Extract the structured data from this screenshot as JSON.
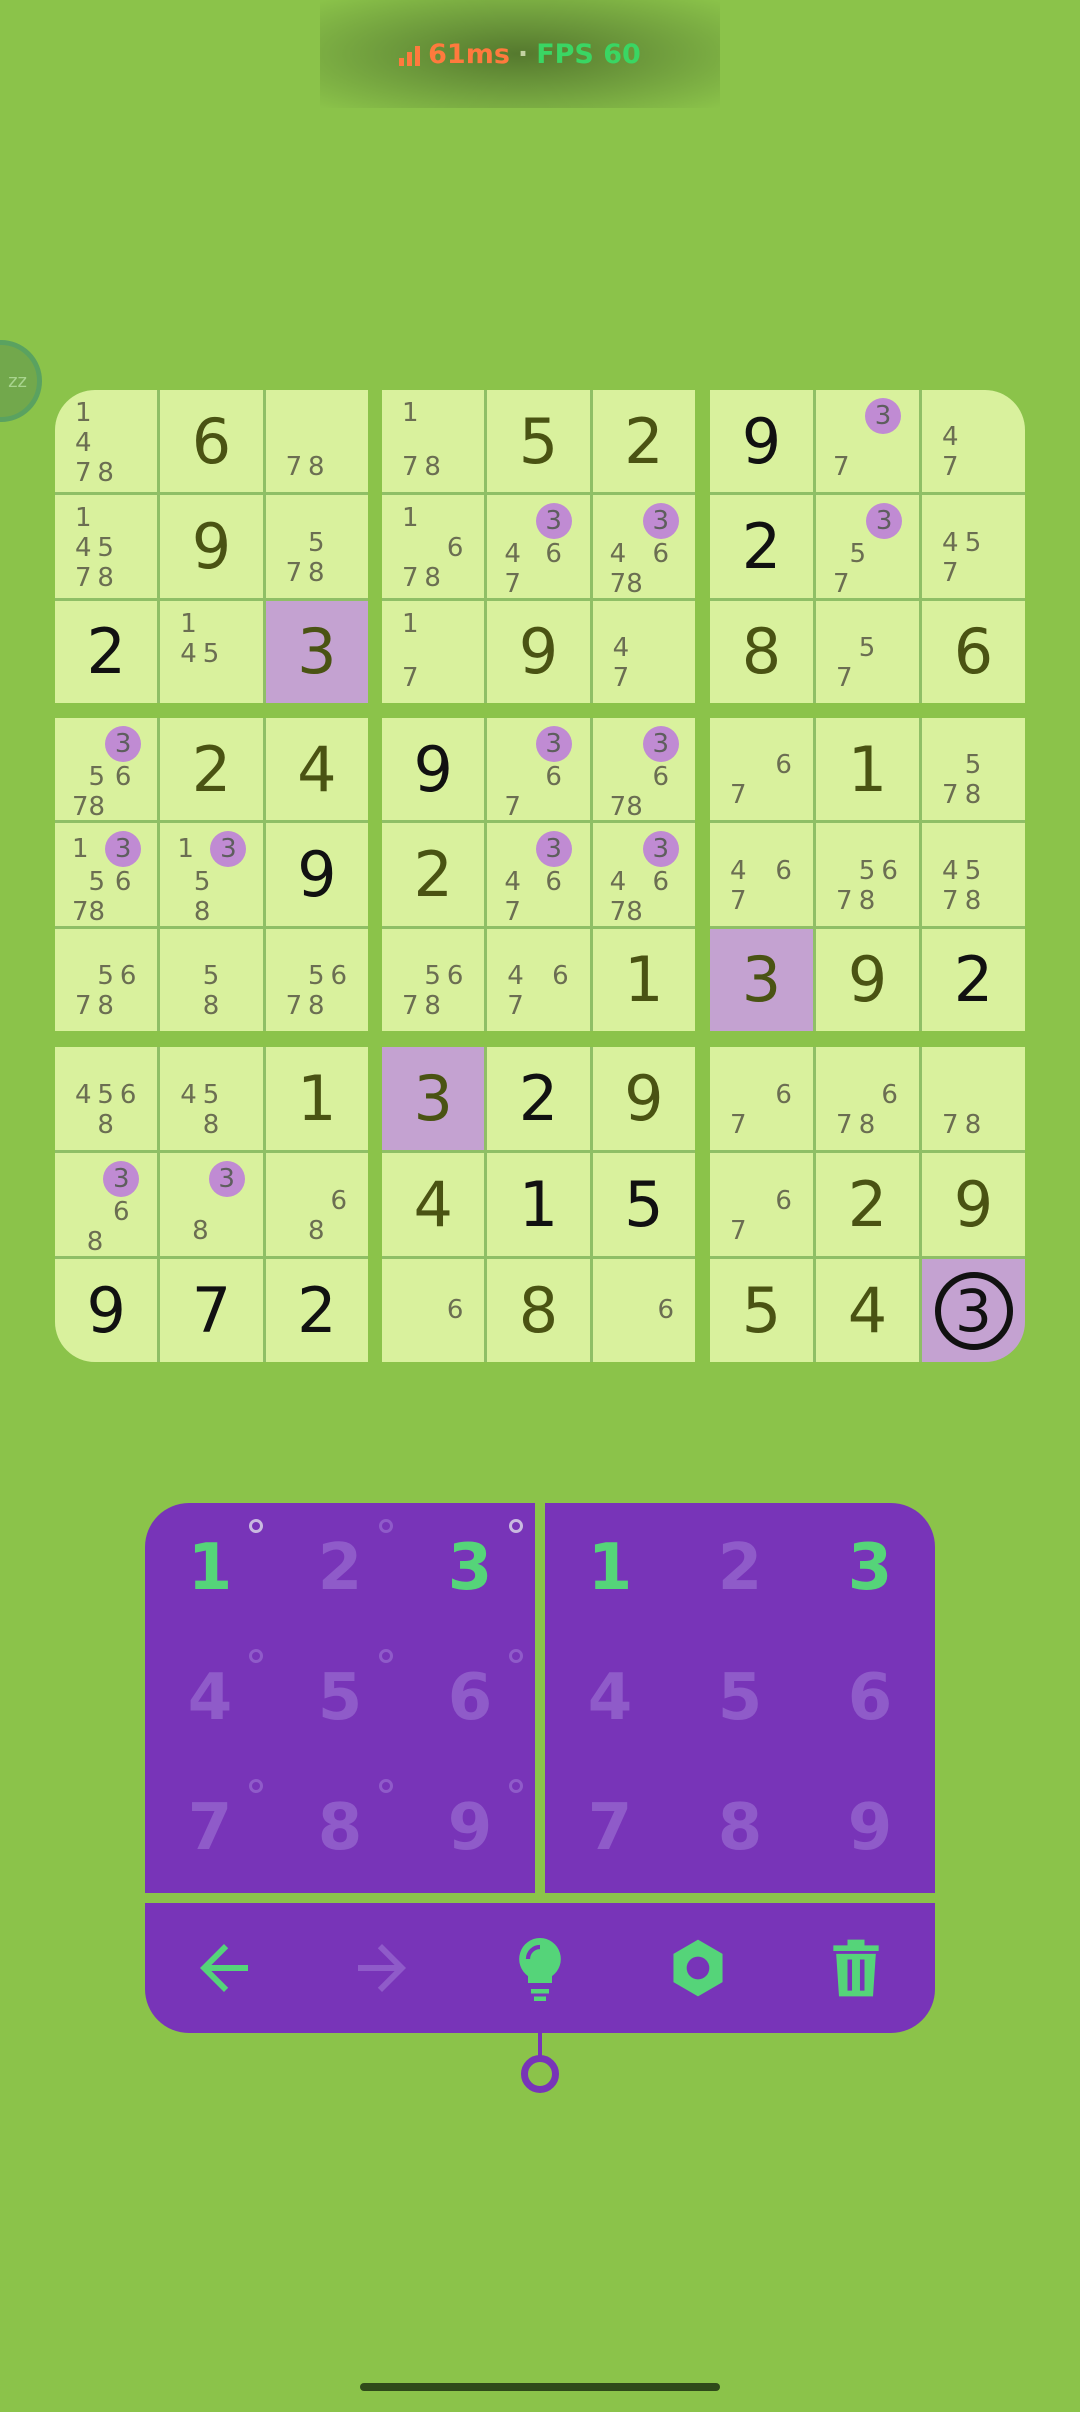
{
  "status": {
    "latency": "61ms",
    "separator": "·",
    "fps": "FPS 60"
  },
  "sleep_badge": {
    "label": "zz"
  },
  "board": {
    "boxes": [
      [
        {
          "v": "",
          "n": [
            "1",
            "",
            "",
            "4",
            "",
            "",
            "7",
            "8",
            ""
          ],
          "m": []
        },
        {
          "v": "6",
          "t": "g",
          "n": [],
          "m": []
        },
        {
          "v": "",
          "n": [
            "",
            "",
            "",
            "",
            "",
            "",
            "7",
            "8",
            ""
          ],
          "m": []
        },
        {
          "v": "",
          "n": [
            "1",
            "",
            "",
            "4",
            "5",
            "",
            "7",
            "8",
            ""
          ],
          "m": []
        },
        {
          "v": "9",
          "t": "g",
          "n": [],
          "m": []
        },
        {
          "v": "",
          "n": [
            "",
            "",
            "",
            "",
            "5",
            "",
            "7",
            "8",
            ""
          ],
          "m": []
        },
        {
          "v": "2",
          "t": "u",
          "n": [],
          "m": []
        },
        {
          "v": "",
          "n": [
            "1",
            "",
            "",
            "4",
            "5",
            "",
            "",
            "",
            ""
          ],
          "m": []
        },
        {
          "v": "3",
          "t": "g",
          "h": true,
          "n": [],
          "m": []
        }
      ],
      [
        {
          "v": "",
          "n": [
            "1",
            "",
            "",
            "",
            "",
            "",
            "7",
            "8",
            ""
          ],
          "m": []
        },
        {
          "v": "5",
          "t": "g",
          "n": [],
          "m": []
        },
        {
          "v": "2",
          "t": "g",
          "n": [],
          "m": []
        },
        {
          "v": "",
          "n": [
            "1",
            "",
            "",
            "",
            "",
            "6",
            "7",
            "8",
            ""
          ],
          "m": []
        },
        {
          "v": "",
          "n": [
            "",
            "",
            "3",
            "4",
            "",
            "6",
            "7",
            "",
            ""
          ],
          "m": [
            "3"
          ]
        },
        {
          "v": "",
          "n": [
            "",
            "",
            "3",
            "4",
            "",
            "6",
            "7",
            "8",
            ""
          ],
          "m": [
            "3"
          ]
        },
        {
          "v": "",
          "n": [
            "1",
            "",
            "",
            "",
            "",
            "",
            "7",
            "",
            ""
          ],
          "m": []
        },
        {
          "v": "9",
          "t": "g",
          "n": [],
          "m": []
        },
        {
          "v": "",
          "n": [
            "",
            "",
            "",
            "4",
            "",
            "",
            "7",
            "",
            ""
          ],
          "m": []
        }
      ],
      [
        {
          "v": "9",
          "t": "u",
          "n": [],
          "m": []
        },
        {
          "v": "",
          "n": [
            "",
            "",
            "3",
            "",
            "",
            "",
            "7",
            "",
            ""
          ],
          "m": [
            "3"
          ]
        },
        {
          "v": "",
          "n": [
            "",
            "",
            "",
            "4",
            "",
            "",
            "7",
            "",
            ""
          ],
          "m": []
        },
        {
          "v": "2",
          "t": "u",
          "n": [],
          "m": []
        },
        {
          "v": "",
          "n": [
            "",
            "",
            "3",
            "",
            "5",
            "",
            "7",
            "",
            ""
          ],
          "m": [
            "3"
          ]
        },
        {
          "v": "",
          "n": [
            "",
            "",
            "",
            "4",
            "5",
            "",
            "7",
            "",
            ""
          ],
          "m": []
        },
        {
          "v": "8",
          "t": "g",
          "n": [],
          "m": []
        },
        {
          "v": "",
          "n": [
            "",
            "",
            "",
            "",
            "5",
            "",
            "7",
            "",
            ""
          ],
          "m": []
        },
        {
          "v": "6",
          "t": "g",
          "n": [],
          "m": []
        }
      ],
      [
        {
          "v": "",
          "n": [
            "",
            "",
            "3",
            "",
            "5",
            "6",
            "7",
            "8",
            ""
          ],
          "m": [
            "3"
          ]
        },
        {
          "v": "2",
          "t": "g",
          "n": [],
          "m": []
        },
        {
          "v": "4",
          "t": "g",
          "n": [],
          "m": []
        },
        {
          "v": "",
          "n": [
            "1",
            "",
            "3",
            "",
            "5",
            "6",
            "7",
            "8",
            ""
          ],
          "m": [
            "3"
          ]
        },
        {
          "v": "",
          "n": [
            "1",
            "",
            "3",
            "",
            "5",
            "",
            "",
            "8",
            ""
          ],
          "m": [
            "3"
          ]
        },
        {
          "v": "9",
          "t": "u",
          "n": [],
          "m": []
        },
        {
          "v": "",
          "n": [
            "",
            "",
            "",
            "",
            "5",
            "6",
            "7",
            "8",
            ""
          ],
          "m": []
        },
        {
          "v": "",
          "n": [
            "",
            "",
            "",
            "",
            "5",
            "",
            "",
            "8",
            ""
          ],
          "m": []
        },
        {
          "v": "",
          "n": [
            "",
            "",
            "",
            "",
            "5",
            "6",
            "7",
            "8",
            ""
          ],
          "m": []
        }
      ],
      [
        {
          "v": "9",
          "t": "u",
          "n": [],
          "m": []
        },
        {
          "v": "",
          "n": [
            "",
            "",
            "3",
            "",
            "",
            "6",
            "7",
            "",
            ""
          ],
          "m": [
            "3"
          ]
        },
        {
          "v": "",
          "n": [
            "",
            "",
            "3",
            "",
            "",
            "6",
            "7",
            "8",
            ""
          ],
          "m": [
            "3"
          ]
        },
        {
          "v": "2",
          "t": "g",
          "n": [],
          "m": []
        },
        {
          "v": "",
          "n": [
            "",
            "",
            "3",
            "4",
            "",
            "6",
            "7",
            "",
            ""
          ],
          "m": [
            "3"
          ]
        },
        {
          "v": "",
          "n": [
            "",
            "",
            "3",
            "4",
            "",
            "6",
            "7",
            "8",
            ""
          ],
          "m": [
            "3"
          ]
        },
        {
          "v": "",
          "n": [
            "",
            "",
            "",
            "",
            "5",
            "6",
            "7",
            "8",
            ""
          ],
          "m": []
        },
        {
          "v": "",
          "n": [
            "",
            "",
            "",
            "4",
            "",
            "6",
            "7",
            "",
            ""
          ],
          "m": []
        },
        {
          "v": "1",
          "t": "g",
          "n": [],
          "m": []
        }
      ],
      [
        {
          "v": "",
          "n": [
            "",
            "",
            "",
            "",
            "",
            "6",
            "7",
            "",
            ""
          ],
          "m": []
        },
        {
          "v": "1",
          "t": "g",
          "n": [],
          "m": []
        },
        {
          "v": "",
          "n": [
            "",
            "",
            "",
            "",
            "5",
            "",
            "7",
            "8",
            ""
          ],
          "m": []
        },
        {
          "v": "",
          "n": [
            "",
            "",
            "",
            "4",
            "",
            "6",
            "7",
            "",
            ""
          ],
          "m": []
        },
        {
          "v": "",
          "n": [
            "",
            "",
            "",
            "",
            "5",
            "6",
            "7",
            "8",
            ""
          ],
          "m": []
        },
        {
          "v": "",
          "n": [
            "",
            "",
            "",
            "4",
            "5",
            "",
            "7",
            "8",
            ""
          ],
          "m": []
        },
        {
          "v": "3",
          "t": "g",
          "h": true,
          "n": [],
          "m": []
        },
        {
          "v": "9",
          "t": "g",
          "n": [],
          "m": []
        },
        {
          "v": "2",
          "t": "u",
          "n": [],
          "m": []
        }
      ],
      [
        {
          "v": "",
          "n": [
            "",
            "",
            "",
            "4",
            "5",
            "6",
            "",
            "8",
            ""
          ],
          "m": []
        },
        {
          "v": "",
          "n": [
            "",
            "",
            "",
            "4",
            "5",
            "",
            "",
            "8",
            ""
          ],
          "m": []
        },
        {
          "v": "1",
          "t": "g",
          "n": [],
          "m": []
        },
        {
          "v": "",
          "n": [
            "",
            "",
            "3",
            "",
            "",
            "6",
            "",
            "8",
            ""
          ],
          "m": [
            "3"
          ]
        },
        {
          "v": "",
          "n": [
            "",
            "",
            "3",
            "",
            "",
            "",
            "",
            "8",
            ""
          ],
          "m": [
            "3"
          ]
        },
        {
          "v": "",
          "n": [
            "",
            "",
            "",
            "",
            "",
            "6",
            "",
            "8",
            ""
          ],
          "m": []
        },
        {
          "v": "9",
          "t": "u",
          "n": [],
          "m": []
        },
        {
          "v": "7",
          "t": "u",
          "n": [],
          "m": []
        },
        {
          "v": "2",
          "t": "u",
          "n": [],
          "m": []
        }
      ],
      [
        {
          "v": "3",
          "t": "g",
          "h": true,
          "n": [],
          "m": []
        },
        {
          "v": "2",
          "t": "u",
          "n": [],
          "m": []
        },
        {
          "v": "9",
          "t": "g",
          "n": [],
          "m": []
        },
        {
          "v": "4",
          "t": "g",
          "n": [],
          "m": []
        },
        {
          "v": "1",
          "t": "u",
          "n": [],
          "m": []
        },
        {
          "v": "5",
          "t": "u",
          "n": [],
          "m": []
        },
        {
          "v": "",
          "n": [
            "",
            "",
            "",
            "",
            "",
            "6",
            "",
            "",
            ""
          ],
          "m": []
        },
        {
          "v": "8",
          "t": "g",
          "n": [],
          "m": []
        },
        {
          "v": "",
          "n": [
            "",
            "",
            "",
            "",
            "",
            "6",
            "",
            "",
            ""
          ],
          "m": []
        }
      ],
      [
        {
          "v": "",
          "n": [
            "",
            "",
            "",
            "",
            "",
            "6",
            "7",
            "",
            ""
          ],
          "m": []
        },
        {
          "v": "",
          "n": [
            "",
            "",
            "",
            "",
            "",
            "6",
            "7",
            "8",
            ""
          ],
          "m": []
        },
        {
          "v": "",
          "n": [
            "",
            "",
            "",
            "",
            "",
            "",
            "7",
            "8",
            ""
          ],
          "m": []
        },
        {
          "v": "",
          "n": [
            "",
            "",
            "",
            "",
            "",
            "6",
            "7",
            "",
            ""
          ],
          "m": []
        },
        {
          "v": "2",
          "t": "g",
          "n": [],
          "m": []
        },
        {
          "v": "9",
          "t": "g",
          "n": [],
          "m": []
        },
        {
          "v": "5",
          "t": "g",
          "n": [],
          "m": []
        },
        {
          "v": "4",
          "t": "g",
          "n": [],
          "m": []
        },
        {
          "v": "3",
          "t": "c",
          "h": true,
          "n": [],
          "m": []
        }
      ]
    ]
  },
  "notes_pad": {
    "keys": [
      {
        "label": "1",
        "active": true
      },
      {
        "label": "2",
        "active": false
      },
      {
        "label": "3",
        "active": true
      },
      {
        "label": "4",
        "active": false
      },
      {
        "label": "5",
        "active": false
      },
      {
        "label": "6",
        "active": false
      },
      {
        "label": "7",
        "active": false
      },
      {
        "label": "8",
        "active": false
      },
      {
        "label": "9",
        "active": false
      }
    ]
  },
  "value_pad": {
    "keys": [
      {
        "label": "1",
        "active": true
      },
      {
        "label": "2",
        "active": false
      },
      {
        "label": "3",
        "active": true
      },
      {
        "label": "4",
        "active": false
      },
      {
        "label": "5",
        "active": false
      },
      {
        "label": "6",
        "active": false
      },
      {
        "label": "7",
        "active": false
      },
      {
        "label": "8",
        "active": false
      },
      {
        "label": "9",
        "active": false
      }
    ]
  },
  "toolbar": {
    "icons": [
      "undo-icon",
      "redo-icon",
      "hint-icon",
      "settings-icon",
      "trash-icon"
    ]
  },
  "colors": {
    "accent": "#55d479",
    "pad": "#7834b8",
    "dim": "#8f5bc9",
    "cell": "#d9f19d",
    "highlight": "#c4a2d1",
    "mark": "#c08bd3",
    "given": "#4a5313",
    "user": "#111111"
  }
}
